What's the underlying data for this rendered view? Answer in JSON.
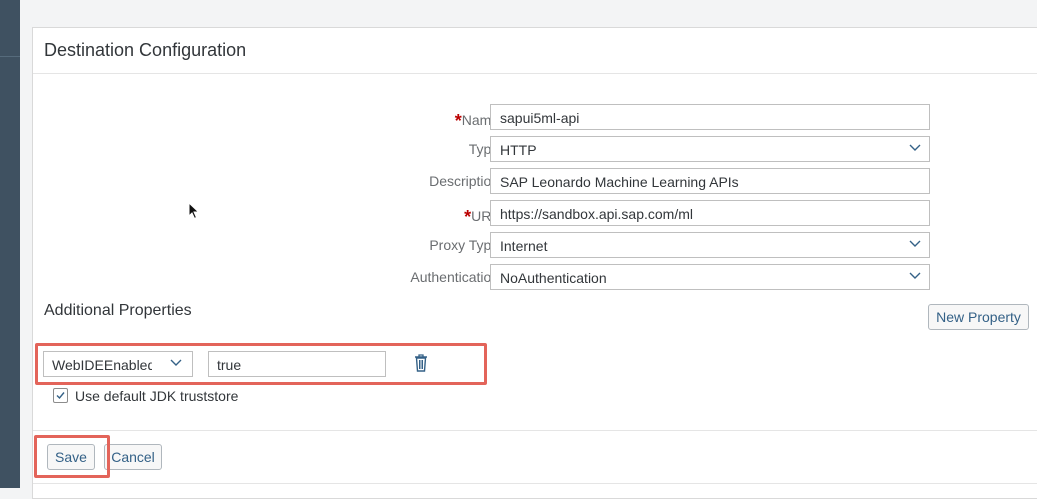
{
  "panel": {
    "title": "Destination Configuration"
  },
  "form": {
    "name": {
      "label": "Name:",
      "required": "*",
      "value": "sapui5ml-api"
    },
    "type": {
      "label": "Type:",
      "value": "HTTP"
    },
    "description": {
      "label": "Description:",
      "value": "SAP Leonardo Machine Learning APIs"
    },
    "url": {
      "label": "URL:",
      "required": "*",
      "value": "https://sandbox.api.sap.com/ml"
    },
    "proxy_type": {
      "label": "Proxy Type:",
      "value": "Internet"
    },
    "authentication": {
      "label": "Authentication:",
      "value": "NoAuthentication"
    }
  },
  "additional_properties": {
    "title": "Additional Properties",
    "new_property_label": "New Property",
    "property": {
      "key": "WebIDEEnabled",
      "value": "true"
    },
    "use_default_jdk_truststore": {
      "label": "Use default JDK truststore",
      "checked": true
    }
  },
  "footer": {
    "save_label": "Save",
    "cancel_label": "Cancel"
  },
  "colors": {
    "required": "#bb0000",
    "highlight": "#e3645a",
    "link": "#346187"
  },
  "icons": [
    "chevron-down-icon",
    "trash-icon",
    "checkmark-icon",
    "mouse-pointer-icon"
  ]
}
